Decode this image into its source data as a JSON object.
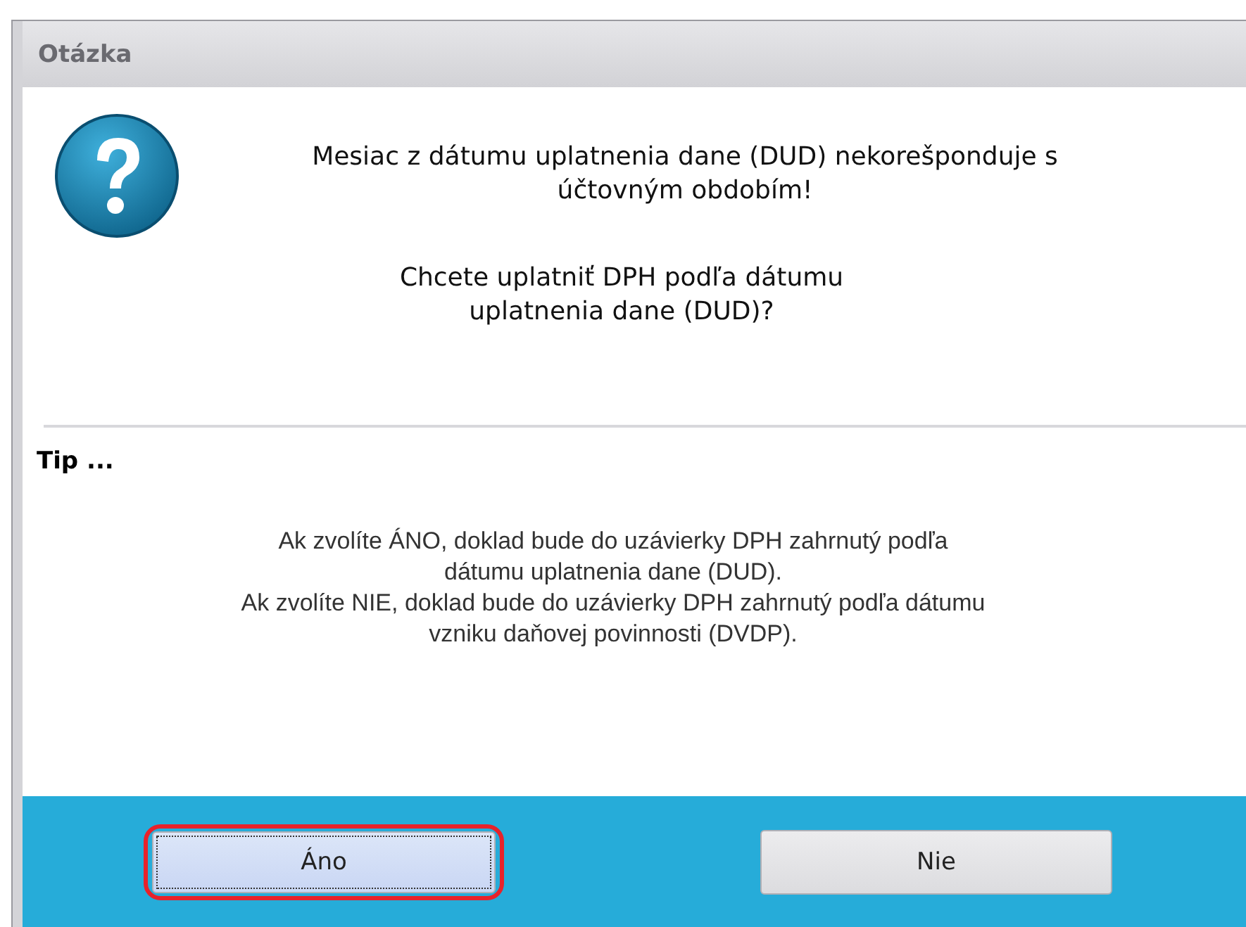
{
  "window": {
    "title": "Otázka"
  },
  "question": {
    "lines": [
      "Mesiac z dátumu uplatnenia dane (DUD) nekorešponduje s",
      "účtovným obdobím!"
    ]
  },
  "prompt": {
    "lines": [
      "Chcete uplatniť DPH podľa dátumu",
      "uplatnenia dane (DUD)?"
    ]
  },
  "tip": {
    "heading": "Tip ...",
    "lines": [
      "Ak zvolíte ÁNO, doklad bude do uzávierky DPH zahrnutý podľa",
      "dátumu uplatnenia dane (DUD).",
      "Ak zvolíte NIE, doklad bude do uzávierky DPH zahrnutý podľa dátumu",
      "vzniku daňovej povinnosti (DVDP)."
    ]
  },
  "buttons": [
    {
      "label": "Áno",
      "focused": true,
      "highlighted": true
    },
    {
      "label": "Nie",
      "focused": false,
      "highlighted": false
    }
  ]
}
